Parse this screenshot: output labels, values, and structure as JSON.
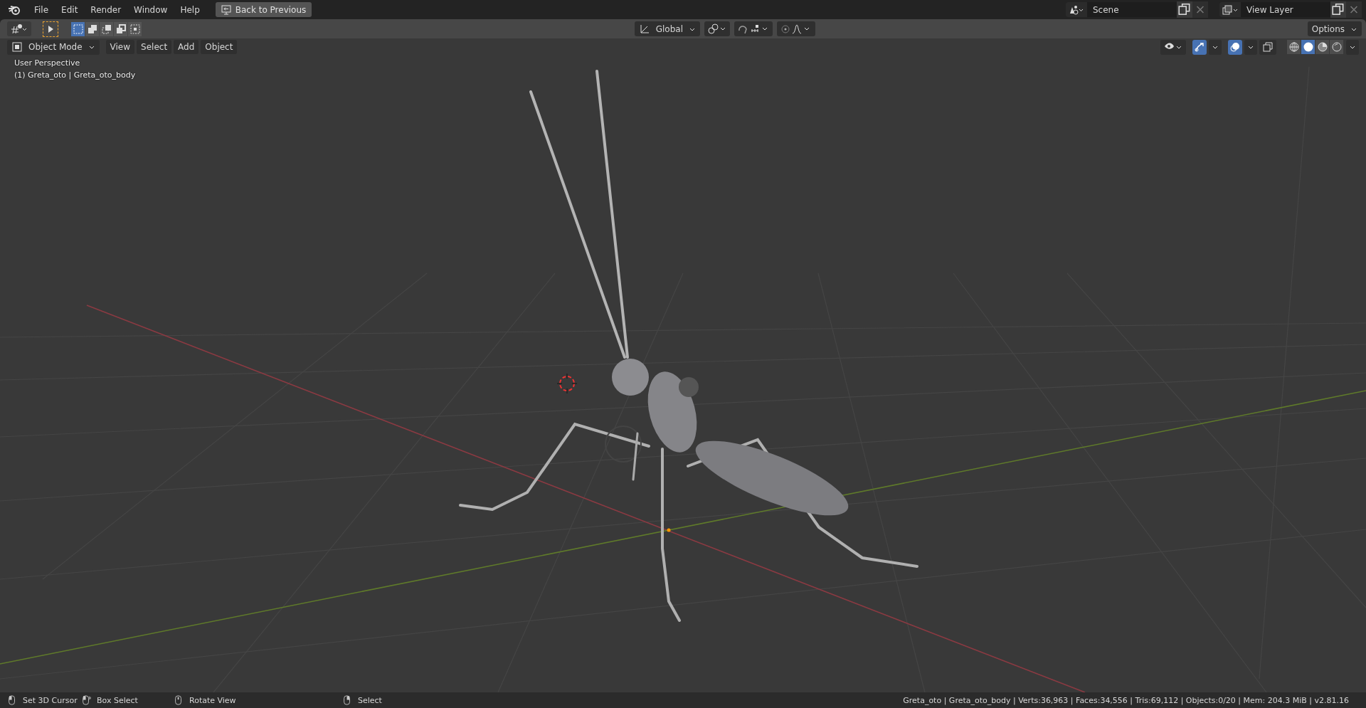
{
  "top_bar": {
    "menus": [
      "File",
      "Edit",
      "Render",
      "Window",
      "Help"
    ],
    "back_button": "Back to Previous",
    "scene": "Scene",
    "view_layer": "View Layer"
  },
  "tool_header": {
    "select_tool_active": true,
    "selection_modes": [
      {
        "kind": "new",
        "selected": true
      },
      {
        "kind": "extend",
        "selected": false
      },
      {
        "kind": "subtract",
        "selected": false
      },
      {
        "kind": "invert",
        "selected": false
      },
      {
        "kind": "intersect",
        "selected": false
      }
    ],
    "transform_orientation": "Global",
    "options": "Options"
  },
  "viewport": {
    "mode": "Object Mode",
    "menus": [
      "View",
      "Select",
      "Add",
      "Object"
    ],
    "overlay_lines": [
      "User Perspective",
      "(1) Greta_oto | Greta_oto_body"
    ],
    "gizmos_on": true,
    "overlays_on": true,
    "shading": [
      {
        "kind": "wireframe",
        "selected": false
      },
      {
        "kind": "solid",
        "selected": true
      },
      {
        "kind": "material",
        "selected": false
      },
      {
        "kind": "rendered",
        "selected": false
      }
    ]
  },
  "status_bar": {
    "hints": [
      {
        "kind": "left",
        "label": "Set 3D Cursor"
      },
      {
        "kind": "drag",
        "label": "Box Select"
      },
      {
        "kind": "middle",
        "label": "Rotate View"
      },
      {
        "kind": "right",
        "label": "Select"
      }
    ],
    "stats": "Greta_oto | Greta_oto_body | Verts:36,963 | Faces:34,556 | Tris:69,112 | Objects:0/20 | Mem: 204.3 MiB | v2.81.16"
  }
}
